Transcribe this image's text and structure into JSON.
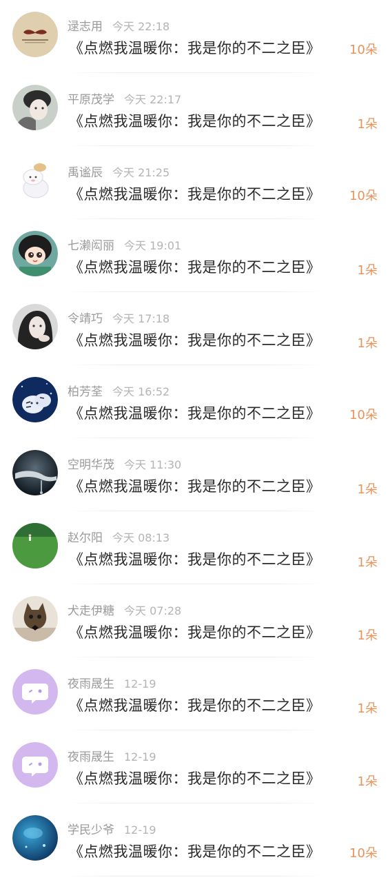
{
  "records": [
    {
      "name": "逯志用",
      "time": "今天 22:18",
      "title": "《点燃我温暖你：我是你的不二之臣》",
      "count": "10朵",
      "avatar": "mustache-avatar-icon"
    },
    {
      "name": "平原茂学",
      "time": "今天 22:17",
      "title": "《点燃我温暖你：我是你的不二之臣》",
      "count": "1朵",
      "avatar": "person-avatar-icon"
    },
    {
      "name": "禹谧辰",
      "time": "今天 21:25",
      "title": "《点燃我温暖你：我是你的不二之臣》",
      "count": "10朵",
      "avatar": "puppy-avatar-icon"
    },
    {
      "name": "七濑闳丽",
      "time": "今天 19:01",
      "title": "《点燃我温暖你：我是你的不二之臣》",
      "count": "1朵",
      "avatar": "anime-girl-avatar-icon"
    },
    {
      "name": "令靖巧",
      "time": "今天 17:18",
      "title": "《点燃我温暖你：我是你的不二之臣》",
      "count": "1朵",
      "avatar": "girl-photo-avatar-icon"
    },
    {
      "name": "柏芳荃",
      "time": "今天 16:52",
      "title": "《点燃我温暖你：我是你的不二之臣》",
      "count": "10朵",
      "avatar": "tiger-avatar-icon"
    },
    {
      "name": "空明华茂",
      "time": "今天 11:30",
      "title": "《点燃我温暖你：我是你的不二之臣》",
      "count": "1朵",
      "avatar": "hand-water-avatar-icon"
    },
    {
      "name": "赵尔阳",
      "time": "今天 08:13",
      "title": "《点燃我温暖你：我是你的不二之臣》",
      "count": "1朵",
      "avatar": "grass-field-avatar-icon"
    },
    {
      "name": "犬走伊糖",
      "time": "今天 07:28",
      "title": "《点燃我温暖你：我是你的不二之臣》",
      "count": "1朵",
      "avatar": "cat-avatar-icon"
    },
    {
      "name": "夜雨晟生",
      "time": "12-19",
      "title": "《点燃我温暖你：我是你的不二之臣》",
      "count": "1朵",
      "avatar": "chat-bubble-avatar-icon"
    },
    {
      "name": "夜雨晟生",
      "time": "12-19",
      "title": "《点燃我温暖你：我是你的不二之臣》",
      "count": "1朵",
      "avatar": "chat-bubble-avatar-icon"
    },
    {
      "name": "学民少爷",
      "time": "12-19",
      "title": "《点燃我温暖你：我是你的不二之臣》",
      "count": "10朵",
      "avatar": "ocean-avatar-icon"
    }
  ],
  "colors": {
    "count": "#e8935a",
    "name": "#9a9a9a",
    "title": "#2a2a2a",
    "default_avatar": "#d3b8f0"
  }
}
